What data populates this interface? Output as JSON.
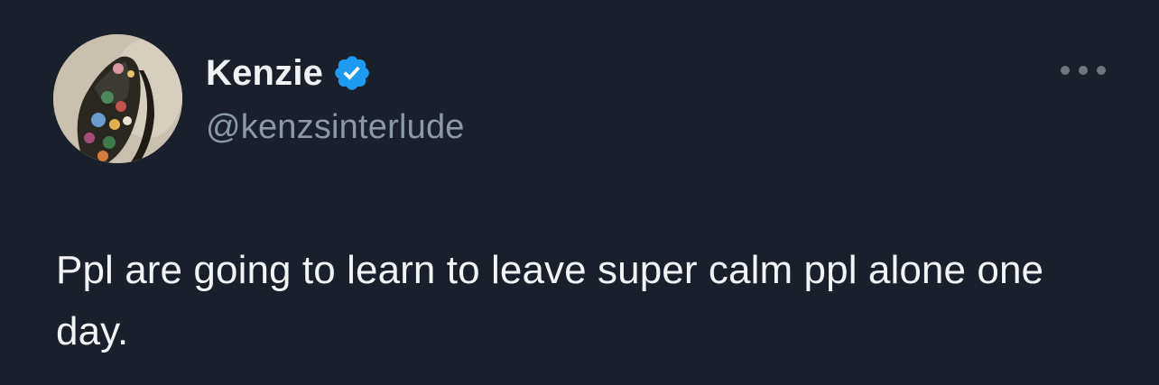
{
  "user": {
    "display_name": "Kenzie",
    "handle": "@kenzsinterlude",
    "verified_icon": "verified-badge-icon",
    "verified_color": "#1d9bf0",
    "avatar_icon": "profile-photo"
  },
  "tweet": {
    "text": "Ppl are going to learn to leave super calm ppl alone one day."
  },
  "menu": {
    "more_icon": "more-options-icon"
  },
  "colors": {
    "background": "#1a202b",
    "text": "#f1f3f5",
    "secondary_text": "#8b98a5"
  }
}
